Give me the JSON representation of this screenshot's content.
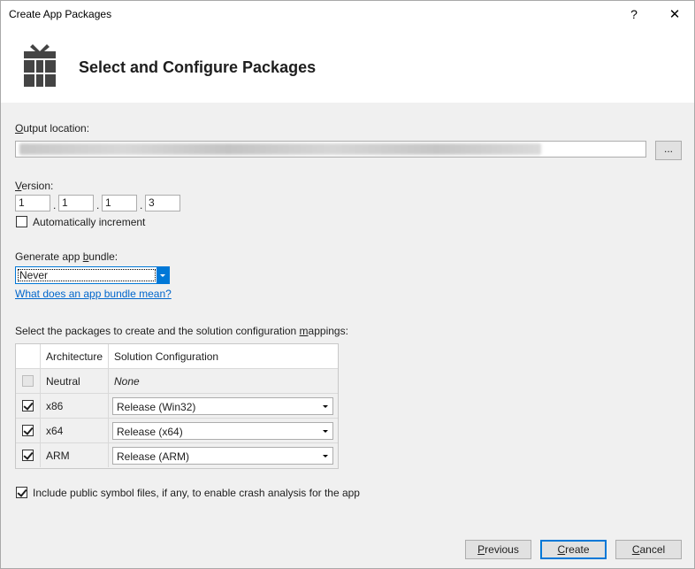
{
  "window": {
    "title": "Create App Packages",
    "help_glyph": "?",
    "close_glyph": "✕"
  },
  "header": {
    "title": "Select and Configure Packages",
    "icon": "gift-package-icon"
  },
  "output": {
    "label_prefix": "O",
    "label_rest": "utput location:",
    "browse_label": "..."
  },
  "version": {
    "label_prefix": "V",
    "label_rest": "ersion:",
    "parts": [
      "1",
      "1",
      "1",
      "3"
    ],
    "separator": ".",
    "auto_increment_label": "Automatically increment",
    "auto_increment_checked": false
  },
  "bundle": {
    "label_before": "Generate app ",
    "label_ul": "b",
    "label_after": "undle:",
    "selected": "Never",
    "help_link": "What does an app bundle mean?"
  },
  "packages": {
    "label_before": "Select the packages to create and the solution configuration ",
    "label_ul": "m",
    "label_after": "appings:",
    "columns": [
      "Architecture",
      "Solution Configuration"
    ],
    "rows": [
      {
        "arch": "Neutral",
        "config": "None",
        "checked": false,
        "disabled": true,
        "dropdown": false
      },
      {
        "arch": "x86",
        "config": "Release (Win32)",
        "checked": true,
        "disabled": false,
        "dropdown": true
      },
      {
        "arch": "x64",
        "config": "Release (x64)",
        "checked": true,
        "disabled": false,
        "dropdown": true
      },
      {
        "arch": "ARM",
        "config": "Release (ARM)",
        "checked": true,
        "disabled": false,
        "dropdown": true
      }
    ]
  },
  "symbols": {
    "label": "Include public symbol files, if any, to enable crash analysis for the app",
    "checked": true
  },
  "footer": {
    "previous_ul": "P",
    "previous_rest": "revious",
    "create_ul": "C",
    "create_rest": "reate",
    "cancel_ul": "C",
    "cancel_rest": "ancel"
  },
  "colors": {
    "accent": "#0078d7",
    "link": "#0066cc",
    "dialog_bg": "#f0f0f0"
  }
}
